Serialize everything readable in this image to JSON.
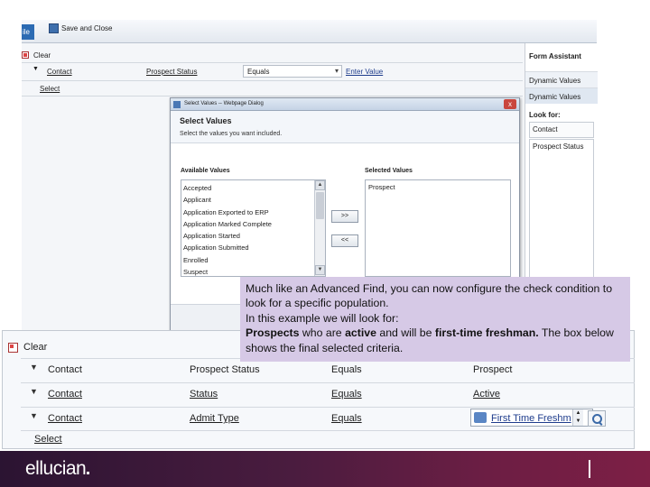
{
  "ribbon": {
    "file_tab": "ile",
    "save_close_label": "Save and Close"
  },
  "top_form": {
    "clear_label": "Clear",
    "criteria": {
      "field": "Contact",
      "attribute": "Prospect Status",
      "operator": "Equals",
      "value_link": "Enter Value"
    },
    "select_label": "Select"
  },
  "form_assistant": {
    "title": "Form Assistant",
    "tabs": [
      "Dynamic Values",
      "Dynamic Values"
    ],
    "look_for_label": "Look for:",
    "look_for_value": "Contact",
    "list_first": "Prospect Status"
  },
  "dialog": {
    "window_title": "Select Values -- Webpage Dialog",
    "close_glyph": "x",
    "heading": "Select Values",
    "instruction": "Select the values you want included.",
    "available_label": "Available Values",
    "selected_label": "Selected Values",
    "available_values": [
      "Accepted",
      "Applicant",
      "Application Exported to ERP",
      "Application Marked Complete",
      "Application Started",
      "Application Submitted",
      "Enrolled",
      "Suspect"
    ],
    "selected_values": [
      "Prospect"
    ],
    "add_button": ">>",
    "remove_button": "<<"
  },
  "final_criteria": {
    "clear_label": "Clear",
    "rows": [
      {
        "field": "Contact",
        "attribute": "Prospect Status",
        "operator": "Equals",
        "value": "Prospect"
      },
      {
        "field": "Contact",
        "attribute": "Status",
        "operator": "Equals",
        "value": "Active"
      },
      {
        "field": "Contact",
        "attribute": "Admit Type",
        "operator": "Equals",
        "value": "First Time Freshm"
      }
    ],
    "select_label": "Select"
  },
  "callout": {
    "line1": "Much like an Advanced Find, you can now configure the check condition to look for a specific population.",
    "line2": "In this example we will look for:",
    "prospects": "Prospects",
    "who_are": " who are ",
    "active": "active",
    "and_will_be": " and will be ",
    "first_time": "first-time freshman.",
    "line3_tail": " The box below shows the final selected criteria."
  },
  "brand": {
    "logo_text": "ellucian"
  },
  "colors": {
    "brand_bar_start": "#2b1432",
    "brand_bar_end": "#7d1f45",
    "callout_bg": "#d6c9e6",
    "link_blue": "#1e3c8c"
  }
}
